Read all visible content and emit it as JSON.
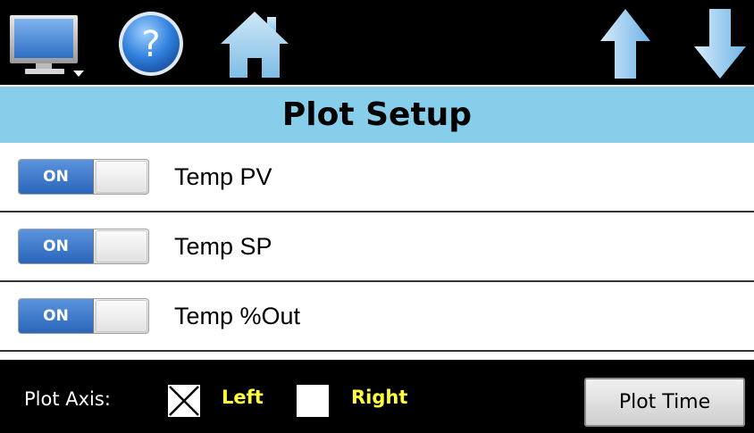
{
  "toolbar": {
    "icons": [
      "monitor-menu-icon",
      "help-icon",
      "home-icon",
      "arrow-up-icon",
      "arrow-down-icon"
    ]
  },
  "title": "Plot Setup",
  "rows": [
    {
      "toggle_label": "ON",
      "state": "on",
      "label": "Temp PV"
    },
    {
      "toggle_label": "ON",
      "state": "on",
      "label": "Temp SP"
    },
    {
      "toggle_label": "ON",
      "state": "on",
      "label": "Temp %Out"
    }
  ],
  "bottom": {
    "axis_label": "Plot Axis:",
    "left_label": "Left",
    "left_checked": true,
    "right_label": "Right",
    "right_checked": false,
    "plot_time_label": "Plot Time"
  },
  "colors": {
    "title_bar": "#87ceeb",
    "toggle_on": "#2a65bb",
    "axis_text": "#ffff3c",
    "icon_blue": "#6bb5e8"
  }
}
